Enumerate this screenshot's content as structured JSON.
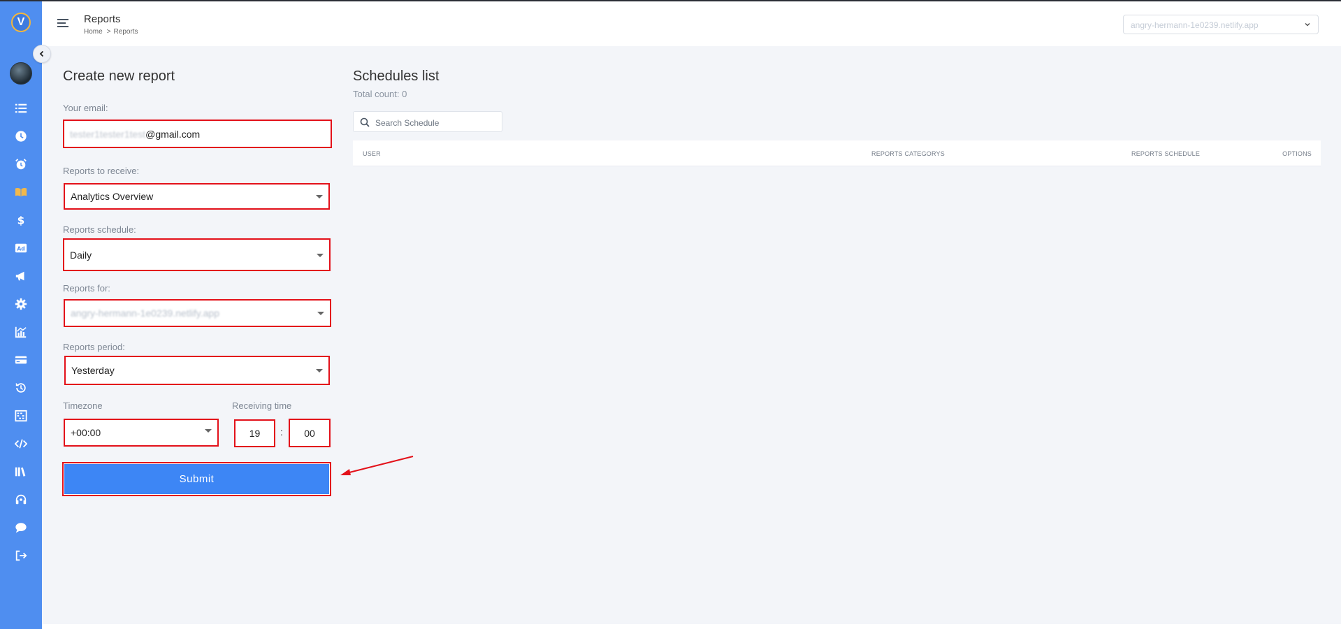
{
  "header": {
    "page_title": "Reports",
    "breadcrumb": {
      "home": "Home",
      "separator": ">",
      "current": "Reports"
    },
    "site_select_value": "angry-hermann-1e0239.netlify.app"
  },
  "sidebar": {
    "logo_letter": "V",
    "items": [
      {
        "icon": "list-icon"
      },
      {
        "icon": "clock-icon"
      },
      {
        "icon": "alarm-clock-icon"
      },
      {
        "icon": "book-open-icon",
        "active": true
      },
      {
        "icon": "dollar-icon"
      },
      {
        "icon": "ad-icon"
      },
      {
        "icon": "megaphone-icon"
      },
      {
        "icon": "gear-icon"
      },
      {
        "icon": "chart-icon"
      },
      {
        "icon": "credit-card-icon"
      },
      {
        "icon": "history-icon"
      },
      {
        "icon": "abacus-icon"
      },
      {
        "icon": "code-icon"
      },
      {
        "icon": "library-icon"
      },
      {
        "icon": "headset-icon"
      },
      {
        "icon": "chat-icon"
      },
      {
        "icon": "logout-icon"
      }
    ]
  },
  "form": {
    "title": "Create new report",
    "email_label": "Your email:",
    "email_value_prefix": "tester1tester1test",
    "email_value_suffix": "@gmail.com",
    "reports_label": "Reports to receive:",
    "reports_value": "Analytics Overview",
    "schedule_label": "Reports schedule:",
    "schedule_value": "Daily",
    "for_label": "Reports for:",
    "for_value": "angry-hermann-1e0239.netlify.app",
    "period_label": "Reports period:",
    "period_value": "Yesterday",
    "timezone_label": "Timezone",
    "timezone_value": "+00:00",
    "time_label": "Receiving time",
    "time_hour": "19",
    "time_separator": ":",
    "time_minute": "00",
    "submit_label": "Submit"
  },
  "schedules": {
    "title": "Schedules list",
    "total_count": "Total count: 0",
    "search_placeholder": "Search Schedule",
    "columns": [
      "USER",
      "REPORTS CATEGORYS",
      "REPORTS SCHEDULE",
      "OPTIONS"
    ]
  },
  "colors": {
    "sidebar": "#4f8ef0",
    "highlight_border": "#e3111a",
    "submit": "#3d86f5",
    "background": "#f3f5f9"
  }
}
